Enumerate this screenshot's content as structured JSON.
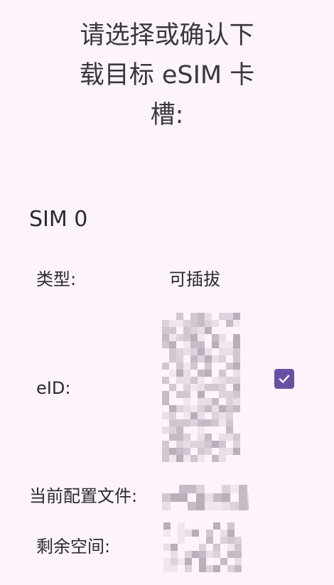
{
  "page_title_lines": [
    "请选择或确认下",
    "载目标 eSIM 卡",
    "槽:"
  ],
  "slot": {
    "name": "SIM 0",
    "type_label": "类型:",
    "type_value": "可插拔",
    "eid_label": "eID:",
    "eid_value_redacted": true,
    "selected": true,
    "current_profile_label": "当前配置文件:",
    "current_profile_value_redacted": true,
    "free_space_label": "剩余空间:",
    "free_space_value_redacted": true
  },
  "colors": {
    "background": "#FCF3FB",
    "accent": "#6750A4",
    "redaction": "#C9BFCB"
  },
  "icons": {
    "selection_checkbox": "checkmark-icon"
  }
}
